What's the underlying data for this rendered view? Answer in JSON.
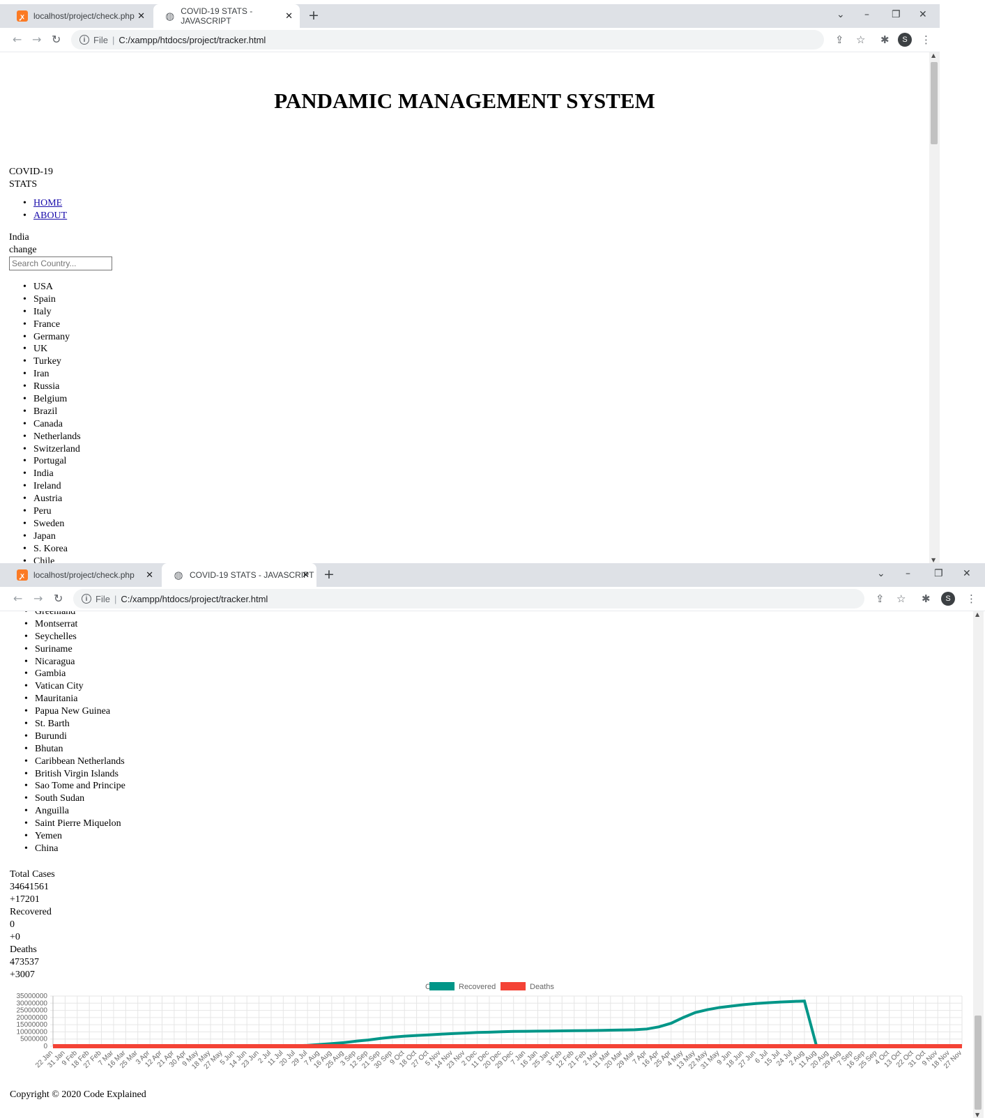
{
  "browser": {
    "tabs": [
      {
        "label": "localhost/project/check.php",
        "icon": "xampp-icon"
      },
      {
        "label": "COVID-19 STATS - JAVASCRIPT",
        "icon": "globe-icon"
      }
    ],
    "url_scheme": "File",
    "url": "C:/xampp/htdocs/project/tracker.html",
    "profile_initial": "S"
  },
  "page": {
    "title": "PANDAMIC MANAGEMENT SYSTEM",
    "logo_line1": "COVID-19",
    "logo_line2": "STATS",
    "nav": [
      "HOME",
      "ABOUT"
    ],
    "country_name": "India",
    "change_label": "change",
    "search_placeholder": "Search Country...",
    "countries_top": [
      "USA",
      "Spain",
      "Italy",
      "France",
      "Germany",
      "UK",
      "Turkey",
      "Iran",
      "Russia",
      "Belgium",
      "Brazil",
      "Canada",
      "Netherlands",
      "Switzerland",
      "Portugal",
      "India",
      "Ireland",
      "Austria",
      "Peru",
      "Sweden",
      "Japan",
      "S. Korea",
      "Chile"
    ],
    "countries_bottom": [
      "Greenland",
      "Montserrat",
      "Seychelles",
      "Suriname",
      "Nicaragua",
      "Gambia",
      "Vatican City",
      "Mauritania",
      "Papua New Guinea",
      "St. Barth",
      "Burundi",
      "Bhutan",
      "Caribbean Netherlands",
      "British Virgin Islands",
      "Sao Tome and Principe",
      "South Sudan",
      "Anguilla",
      "Saint Pierre Miquelon",
      "Yemen",
      "China"
    ],
    "stats": {
      "cases_label": "Total Cases",
      "cases_value": "34641561",
      "cases_new": "+17201",
      "recovered_label": "Recovered",
      "recovered_value": "0",
      "recovered_new": "+0",
      "deaths_label": "Deaths",
      "deaths_value": "473537",
      "deaths_new": "+3007"
    },
    "footer": "Copyright © 2020 Code Explained"
  },
  "chart_data": {
    "type": "line",
    "legend": [
      {
        "name": "Cases",
        "color": "#ffffff"
      },
      {
        "name": "Recovered",
        "color": "#009688"
      },
      {
        "name": "Deaths",
        "color": "#f44336"
      }
    ],
    "legend_position": "top",
    "grid": true,
    "ylim": [
      0,
      35000000
    ],
    "y_ticks": [
      "35000000",
      "30000000",
      "25000000",
      "20000000",
      "15000000",
      "10000000",
      "5000000",
      "0"
    ],
    "x_ticks": [
      "22 Jan",
      "31 Jan",
      "9 Feb",
      "18 Feb",
      "27 Feb",
      "7 Mar",
      "16 Mar",
      "25 Mar",
      "3 Apr",
      "12 Apr",
      "21 Apr",
      "30 Apr",
      "9 May",
      "18 May",
      "27 May",
      "5 Jun",
      "14 Jun",
      "23 Jun",
      "2 Jul",
      "11 Jul",
      "20 Jul",
      "29 Jul",
      "7 Aug",
      "16 Aug",
      "25 Aug",
      "3 Sep",
      "12 Sep",
      "21 Sep",
      "30 Sep",
      "9 Oct",
      "18 Oct",
      "27 Oct",
      "5 Nov",
      "14 Nov",
      "23 Nov",
      "2 Dec",
      "11 Dec",
      "20 Dec",
      "29 Dec",
      "7 Jan",
      "16 Jan",
      "25 Jan",
      "3 Feb",
      "12 Feb",
      "21 Feb",
      "2 Mar",
      "11 Mar",
      "20 Mar",
      "29 Mar",
      "7 Apr",
      "16 Apr",
      "25 Apr",
      "4 May",
      "13 May",
      "22 May",
      "31 May",
      "9 Jun",
      "18 Jun",
      "27 Jun",
      "6 Jul",
      "15 Jul",
      "24 Jul",
      "2 Aug",
      "11 Aug",
      "20 Aug",
      "29 Aug",
      "7 Sep",
      "16 Sep",
      "25 Sep",
      "4 Oct",
      "13 Oct",
      "22 Oct",
      "31 Oct",
      "9 Nov",
      "18 Nov",
      "27 Nov"
    ],
    "series": [
      {
        "name": "Cases",
        "color": "#009688",
        "values": [
          0,
          0,
          0,
          0,
          0,
          0,
          0,
          0,
          0,
          0,
          0,
          0,
          0,
          0,
          0,
          0,
          0,
          0,
          0,
          100000,
          300000,
          600000,
          1200000,
          1800000,
          2500000,
          3500000,
          4300000,
          5400000,
          6300000,
          7000000,
          7500000,
          7900000,
          8400000,
          8800000,
          9200000,
          9600000,
          9800000,
          10100000,
          10300000,
          10400000,
          10500000,
          10600000,
          10700000,
          10800000,
          10900000,
          11000000,
          11200000,
          11300000,
          11500000,
          12000000,
          13500000,
          16000000,
          20000000,
          23500000,
          25500000,
          27000000,
          28000000,
          29000000,
          29800000,
          30300000,
          30800000,
          31200000,
          31500000,
          0,
          0,
          0,
          0,
          0,
          0,
          0,
          0,
          0,
          0,
          0,
          0,
          0
        ]
      },
      {
        "name": "Deaths",
        "color": "#f44336",
        "values": [
          0,
          0,
          0,
          0,
          0,
          0,
          0,
          0,
          0,
          0,
          0,
          0,
          0,
          0,
          0,
          0,
          0,
          0,
          0,
          0,
          0,
          0,
          0,
          0,
          0,
          0,
          0,
          0,
          0,
          0,
          0,
          0,
          0,
          0,
          0,
          0,
          0,
          0,
          0,
          0,
          0,
          0,
          0,
          0,
          0,
          0,
          0,
          0,
          0,
          0,
          0,
          0,
          0,
          0,
          0,
          0,
          0,
          0,
          0,
          0,
          0,
          0,
          0,
          0,
          0,
          0,
          0,
          0,
          0,
          0,
          0,
          0,
          0,
          0,
          0,
          0
        ]
      }
    ]
  }
}
